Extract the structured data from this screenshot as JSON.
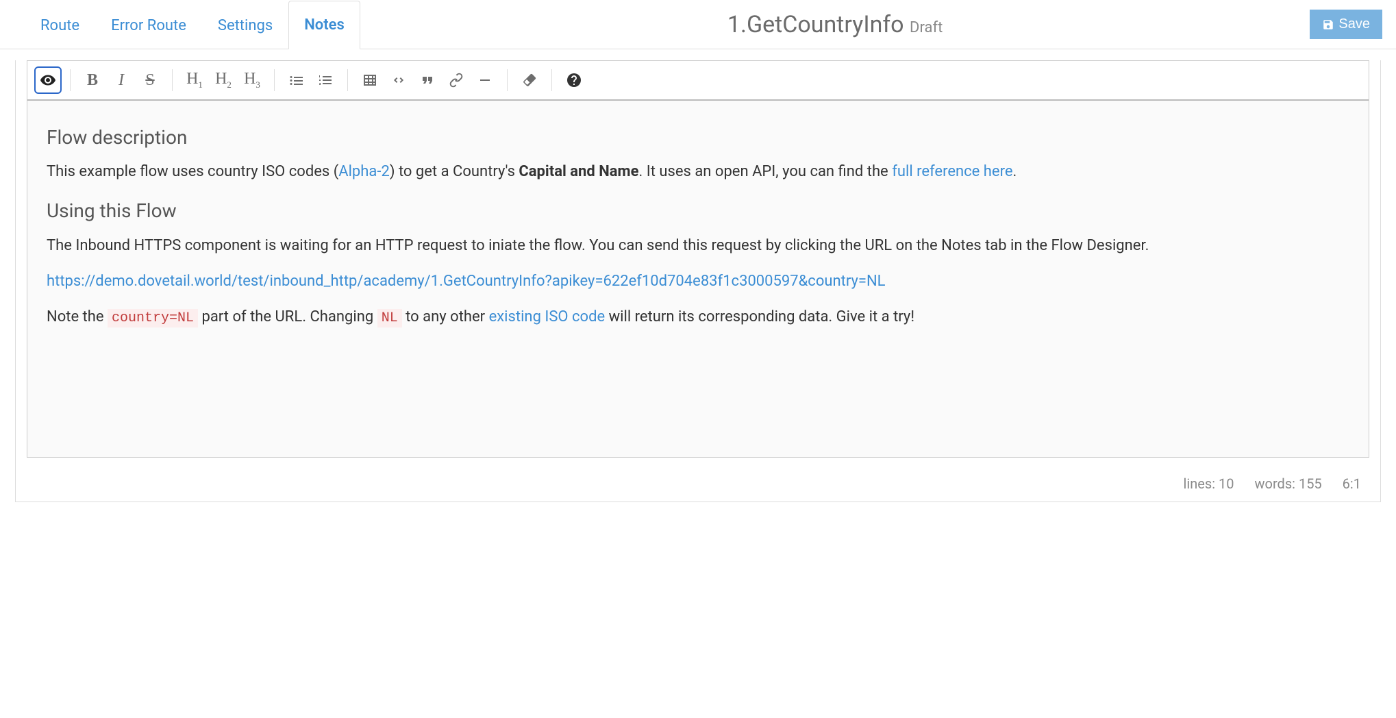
{
  "tabs": {
    "route": "Route",
    "error_route": "Error Route",
    "settings": "Settings",
    "notes": "Notes"
  },
  "header": {
    "title": "1.GetCountryInfo",
    "status": "Draft",
    "save_label": "Save"
  },
  "toolbar": {
    "h1": "H",
    "h1_sub": "1",
    "h2": "H",
    "h2_sub": "2",
    "h3": "H",
    "h3_sub": "3",
    "bold": "B",
    "italic": "I",
    "strike": "S"
  },
  "content": {
    "h_flow": "Flow description",
    "p1_a": "This example flow uses country ISO codes (",
    "p1_link1": "Alpha-2",
    "p1_b": ") to get a Country's ",
    "p1_bold": "Capital and Name",
    "p1_c": ". It uses an open API, you can find the ",
    "p1_link2": "full reference here",
    "p1_d": ".",
    "h_using": "Using this Flow",
    "p2": "The Inbound HTTPS component is waiting for an HTTP request to iniate the flow. You can send this request by clicking the URL on the Notes tab in the Flow Designer.",
    "p3_link": "https://demo.dovetail.world/test/inbound_http/academy/1.GetCountryInfo?apikey=622ef10d704e83f1c3000597&country=NL",
    "p4_a": "Note the ",
    "p4_code1": "country=NL",
    "p4_b": " part of the URL. Changing ",
    "p4_code2": "NL",
    "p4_c": " to any other ",
    "p4_link": "existing ISO code",
    "p4_d": " will return its corresponding data. Give it a try!"
  },
  "status": {
    "lines": "lines: 10",
    "words": "words: 155",
    "cursor": "6:1"
  }
}
